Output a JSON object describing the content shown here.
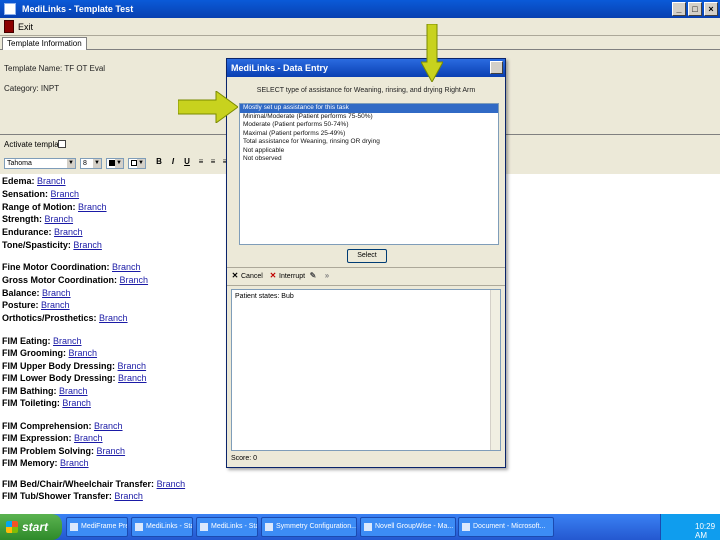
{
  "window": {
    "title": "MediLinks - Template Test"
  },
  "toolbar": {
    "exit_label": "Exit"
  },
  "tabs": [
    {
      "label": "Template Information"
    }
  ],
  "info": {
    "name_label": "Template Name:",
    "name_value": "TF OT Eval",
    "category_label": "Category:",
    "category_value": "INPT"
  },
  "editor": {
    "activate_label": "Activate template",
    "font_value": "Tahoma",
    "size_value": "8"
  },
  "document": {
    "lines": [
      {
        "label": "Edema:",
        "link": "Branch"
      },
      {
        "label": "Sensation:",
        "link": "Branch"
      },
      {
        "label": "Range of Motion:",
        "link": "Branch"
      },
      {
        "label": "Strength:",
        "link": "Branch"
      },
      {
        "label": "Endurance:",
        "link": "Branch"
      },
      {
        "label": "Tone/Spasticity:",
        "link": "Branch"
      },
      {
        "label": "Fine Motor Coordination:",
        "link": "Branch"
      },
      {
        "label": "Gross Motor Coordination:",
        "link": "Branch"
      },
      {
        "label": "Balance:",
        "link": "Branch"
      },
      {
        "label": "Posture:",
        "link": "Branch"
      },
      {
        "label": "Orthotics/Prosthetics:",
        "link": "Branch"
      },
      {
        "label": "FIM Eating:",
        "link": "Branch"
      },
      {
        "label": "FIM Grooming:",
        "link": "Branch"
      },
      {
        "label": "FIM Upper Body Dressing:",
        "link": "Branch"
      },
      {
        "label": "FIM Lower Body Dressing:",
        "link": "Branch"
      },
      {
        "label": "FIM Bathing:",
        "link": "Branch"
      },
      {
        "label": "FIM Toileting:",
        "link": "Branch"
      },
      {
        "label": "FIM Comprehension:",
        "link": "Branch"
      },
      {
        "label": "FIM Expression:",
        "link": "Branch"
      },
      {
        "label": "FIM Problem Solving:",
        "link": "Branch"
      },
      {
        "label": "FIM Memory:",
        "link": "Branch"
      },
      {
        "label": "FIM Bed/Chair/Wheelchair Transfer:",
        "link": "Branch"
      },
      {
        "label": "FIM Tub/Shower Transfer:",
        "link": "Branch"
      }
    ]
  },
  "dialog": {
    "title": "MediLinks - Data Entry",
    "prompt": "SELECT type of assistance for Weaning, rinsing, and drying Right Arm",
    "options": [
      "Mostly set up assistance for this task",
      "Minimal/Moderate (Patient performs 75-50%)",
      "Moderate (Patient performs 50-74%)",
      "Maximal (Patient performs 25-49%)",
      "Total assistance for Weaning, rinsing OR drying",
      "Not applicable",
      "Not observed"
    ],
    "selected_index": 0,
    "select_label": "Select",
    "cancel_label": "Cancel",
    "interrupt_label": "Interrupt",
    "text_value": "Patient states: Bub",
    "status": "Score: 0"
  },
  "taskbar": {
    "start_label": "start",
    "tasks": [
      "MediFrame Presentati...",
      "MediLinks - Status P...",
      "MediLinks - Status P...",
      "Symmetry Configuration...",
      "Novell GroupWise - Ma...",
      "Document - Microsoft..."
    ],
    "clock": "10:29 AM"
  },
  "colors": {
    "arrow": "#c8d21e",
    "selection": "#316ac5",
    "titlebar": "#0a5ad8"
  }
}
